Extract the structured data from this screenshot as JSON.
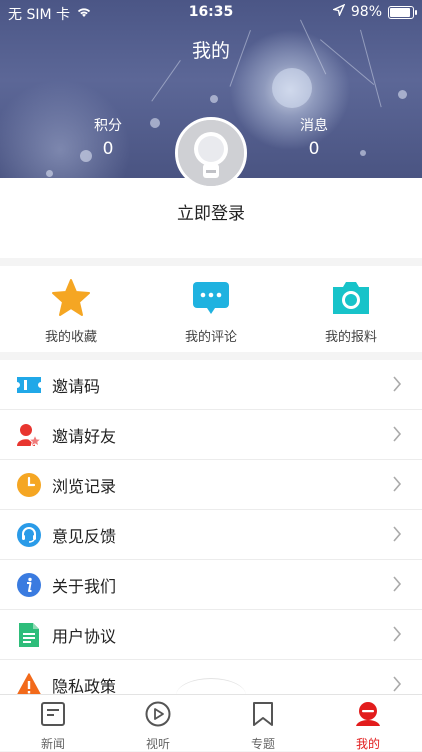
{
  "status": {
    "carrier": "无 SIM 卡",
    "time": "16:35",
    "battery": "98%",
    "battery_level": 0.98
  },
  "header": {
    "title": "我的",
    "points_label": "积分",
    "points_value": "0",
    "messages_label": "消息",
    "messages_value": "0"
  },
  "profile": {
    "login_label": "立即登录"
  },
  "quick_actions": [
    {
      "label": "我的收藏",
      "icon": "star-icon",
      "color": "#f5a623"
    },
    {
      "label": "我的评论",
      "icon": "comment-icon",
      "color": "#1fb2e0"
    },
    {
      "label": "我的报料",
      "icon": "camera-icon",
      "color": "#17c3c9"
    }
  ],
  "menu": [
    {
      "label": "邀请码",
      "icon": "ticket-icon",
      "color": "#20a8e8"
    },
    {
      "label": "邀请好友",
      "icon": "invite-friend-icon",
      "color": "#e8352f"
    },
    {
      "label": "浏览记录",
      "icon": "clock-icon",
      "color": "#f5a623"
    },
    {
      "label": "意见反馈",
      "icon": "headset-icon",
      "color": "#2a9be8"
    },
    {
      "label": "关于我们",
      "icon": "info-icon",
      "color": "#3a7be0"
    },
    {
      "label": "用户协议",
      "icon": "document-icon",
      "color": "#2ebd7a"
    },
    {
      "label": "隐私政策",
      "icon": "warning-icon",
      "color": "#f26a1b"
    }
  ],
  "tabs": [
    {
      "label": "新闻",
      "icon": "news-icon",
      "active": false
    },
    {
      "label": "视听",
      "icon": "play-icon",
      "active": false
    },
    {
      "label": "专题",
      "icon": "bookmark-icon",
      "active": false
    },
    {
      "label": "我的",
      "icon": "profile-tab-icon",
      "active": true
    }
  ],
  "colors": {
    "accent_red": "#e21c1c"
  }
}
